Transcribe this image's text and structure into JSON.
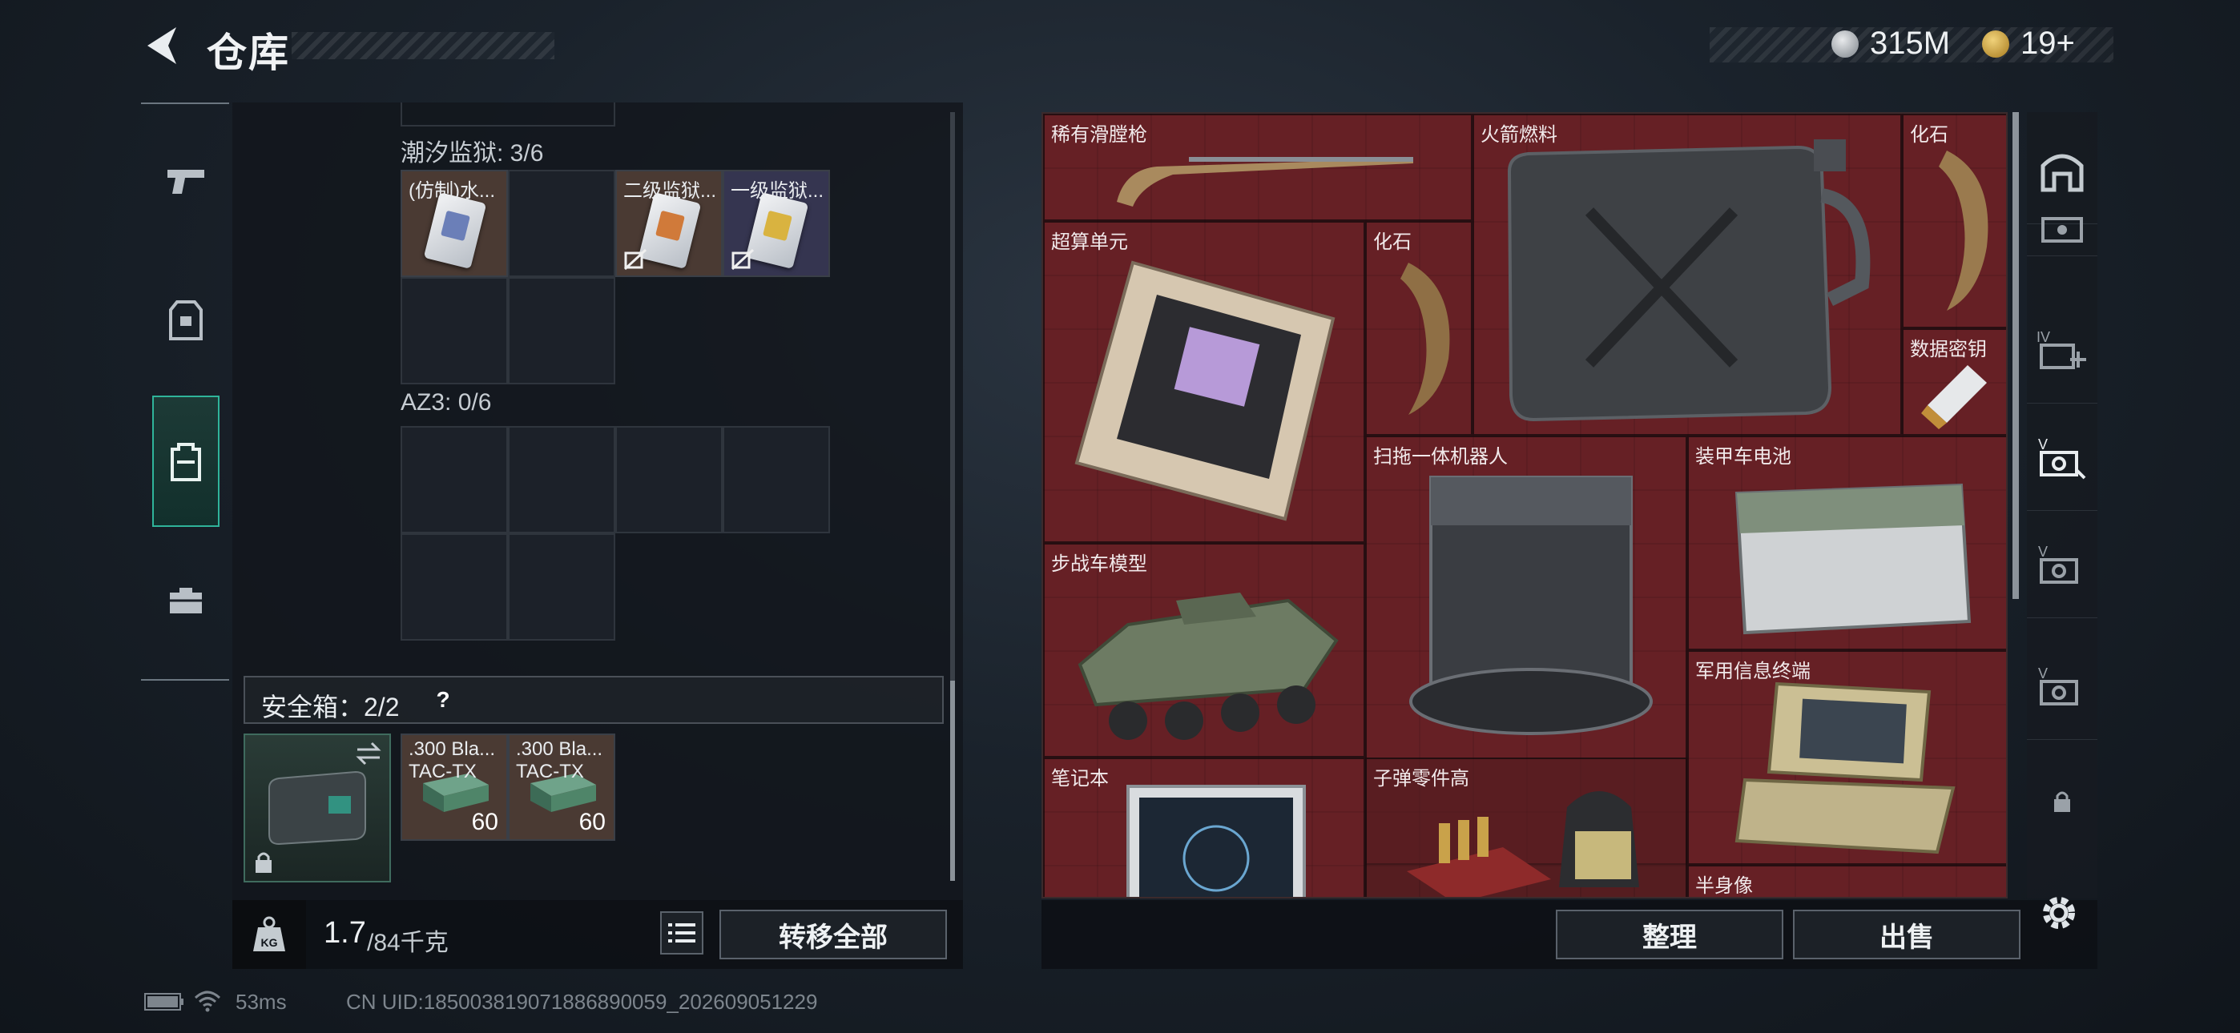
{
  "header": {
    "title": "仓库",
    "currency_1": "315M",
    "currency_2": "19+"
  },
  "left_panel": {
    "sections": [
      {
        "label": "潮汐监狱: 3/6",
        "items": [
          {
            "label": "(仿制)水..."
          },
          {
            "label": "二级监狱..."
          },
          {
            "label": "一级监狱..."
          }
        ]
      },
      {
        "label": "AZ3: 0/6",
        "items": []
      }
    ],
    "safebox": {
      "label": "安全箱：2/2",
      "help": "?",
      "items": [
        {
          "label": ".300 Bla...",
          "sublabel": "TAC-TX",
          "count": "60"
        },
        {
          "label": ".300 Bla...",
          "sublabel": "TAC-TX",
          "count": "60"
        }
      ]
    },
    "footer": {
      "weight_current": "1.7",
      "weight_max": "/84千克",
      "transfer_all": "转移全部"
    }
  },
  "storage": {
    "items": [
      {
        "label": "稀有滑膛枪"
      },
      {
        "label": "火箭燃料"
      },
      {
        "label": "化石"
      },
      {
        "label": "超算单元"
      },
      {
        "label": "化石"
      },
      {
        "label": "数据密钥"
      },
      {
        "label": "扫拖一体机器人"
      },
      {
        "label": "装甲车电池"
      },
      {
        "label": "步战车模型"
      },
      {
        "label": "军用信息终端"
      },
      {
        "label": "笔记本"
      },
      {
        "label": "子弹零件高"
      },
      {
        "label": "半身像"
      }
    ],
    "footer": {
      "organize": "整理",
      "sell": "出售"
    }
  },
  "statusbar": {
    "ping": "53ms",
    "uid": "CN UID:185003819071886890059_202609051229"
  },
  "colors": {
    "storage_bg": "#5e1e22",
    "active_nav": "#2fb49a",
    "panel_bg": "#12161c"
  }
}
